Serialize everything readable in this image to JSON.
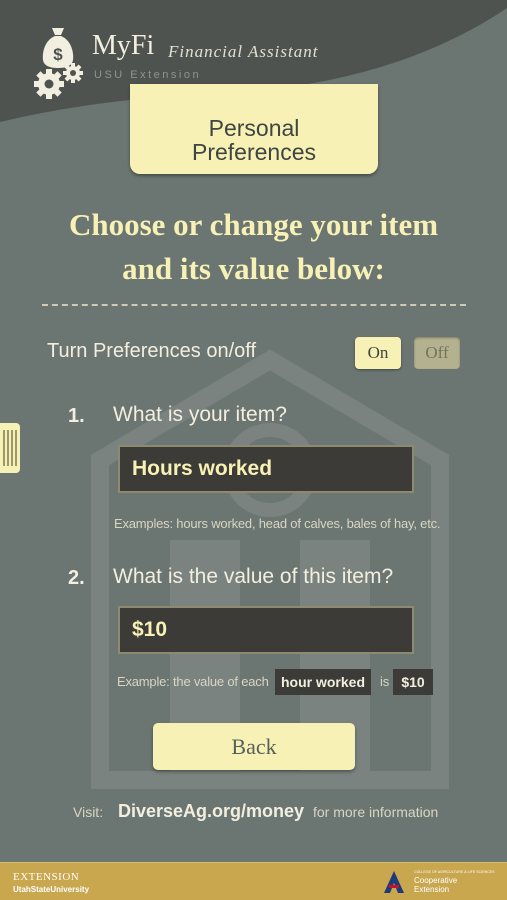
{
  "app": {
    "title": "MyFi",
    "subtitle": "Financial Assistant",
    "org": "USU Extension"
  },
  "section_tab": [
    "Personal",
    "Preferences"
  ],
  "heading": [
    "Choose or change your item",
    "and its value below:"
  ],
  "toggle": {
    "label": "Turn Preferences on/off",
    "on_label": "On",
    "off_label": "Off",
    "state": "On"
  },
  "questions": [
    {
      "number": "1.",
      "text": "What is your item?",
      "value": "Hours worked",
      "example": "Examples: hours worked, head of calves, bales of hay, etc."
    },
    {
      "number": "2.",
      "text": "What is the value of this item?",
      "value": "$10",
      "example_prefix": "Example: the value of each",
      "example_item": "hour worked",
      "example_is": "is",
      "example_value": "$10"
    }
  ],
  "back_label": "Back",
  "visit": {
    "label": "Visit:",
    "link": "DiverseAg.org/money",
    "tail": "for more information"
  },
  "footer": {
    "extension": "EXTENSION",
    "university": "UtahStateUniversity",
    "college_small": "COLLEGE OF AGRICULTURE & LIFE SCIENCES",
    "cooperative": "Cooperative",
    "coop_ext": "Extension"
  },
  "colors": {
    "background": "#6b7571",
    "accent_cream": "#f8f1b6",
    "field_bg": "#3c3b37",
    "footer_gold": "#c9a74f"
  },
  "icons": {
    "logo": "money-bag-icon",
    "gears": "gears-icon",
    "side_handle": "drawer-handle-icon",
    "footer_logo": "university-a-logo-icon"
  }
}
